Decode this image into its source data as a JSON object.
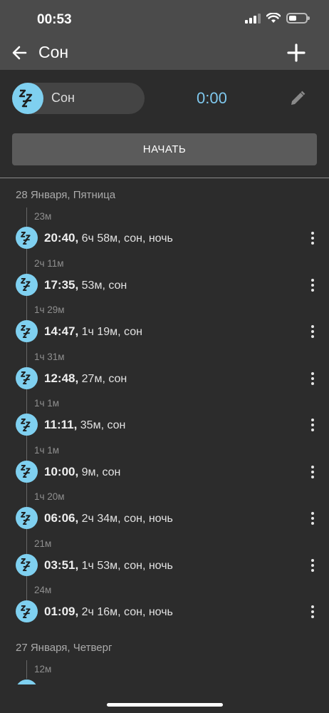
{
  "status": {
    "time": "00:53"
  },
  "header": {
    "title": "Сон"
  },
  "current": {
    "activity_label": "Сон",
    "timer": "0:00",
    "start_label": "НАЧАТЬ"
  },
  "days": [
    {
      "label": "28 Января, Пятница",
      "entries": [
        {
          "gap": "23м",
          "time": "20:40,",
          "detail": "6ч 58м, сон, ночь"
        },
        {
          "gap": "2ч 11м",
          "time": "17:35,",
          "detail": "53м, сон"
        },
        {
          "gap": "1ч 29м",
          "time": "14:47,",
          "detail": "1ч 19м, сон"
        },
        {
          "gap": "1ч 31м",
          "time": "12:48,",
          "detail": "27м, сон"
        },
        {
          "gap": "1ч 1м",
          "time": "11:11,",
          "detail": "35м, сон"
        },
        {
          "gap": "1ч 1м",
          "time": "10:00,",
          "detail": "9м, сон"
        },
        {
          "gap": "1ч 20м",
          "time": "06:06,",
          "detail": "2ч 34м, сон, ночь"
        },
        {
          "gap": "21м",
          "time": "03:51,",
          "detail": "1ч 53м, сон, ночь"
        },
        {
          "gap": "24м",
          "time": "01:09,",
          "detail": "2ч 16м, сон, ночь"
        }
      ]
    },
    {
      "label": "27 Января, Четверг",
      "entries": [
        {
          "gap": "12м"
        }
      ]
    }
  ],
  "colors": {
    "accent": "#7fd0f0",
    "timer": "#7fc8ee",
    "topbar": "#4b4b4b",
    "background": "#2c2c2c"
  },
  "icons": [
    "back-arrow-icon",
    "plus-icon",
    "sleep-zzz-icon",
    "pencil-icon",
    "more-vertical-icon",
    "signal-icon",
    "wifi-icon",
    "battery-icon"
  ]
}
